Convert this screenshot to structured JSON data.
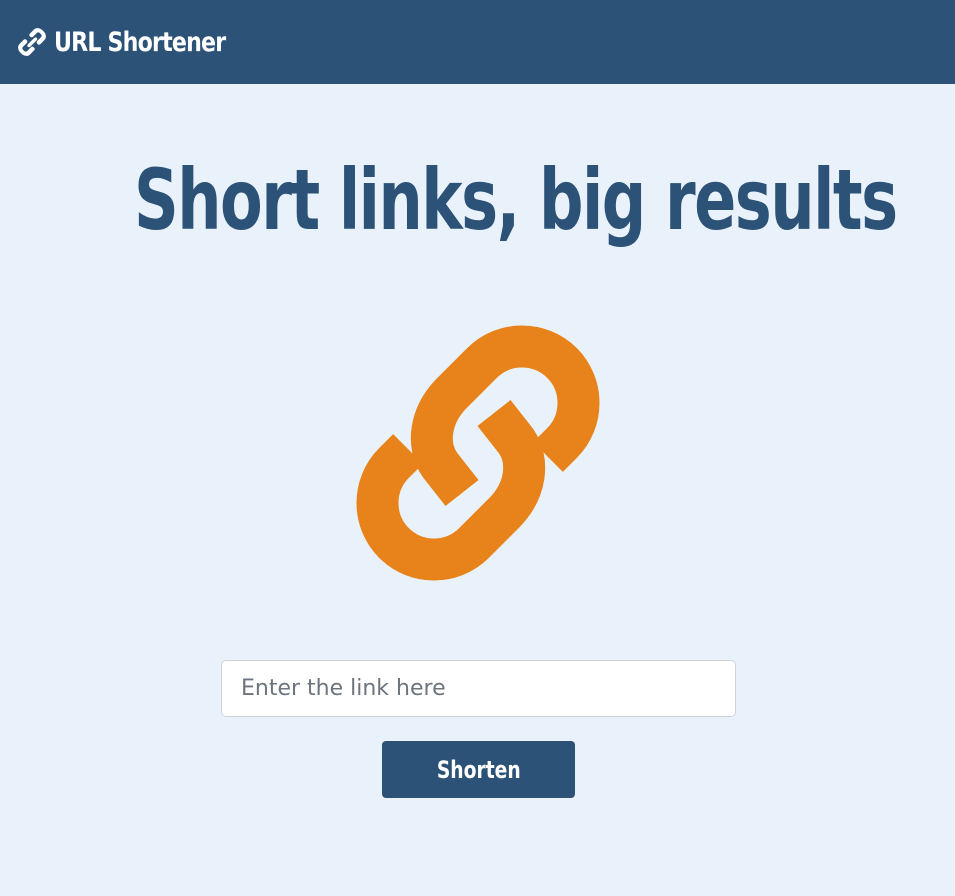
{
  "navbar": {
    "brand_icon": "link-icon",
    "brand_text": "URL Shortener",
    "background_color": "#2c5277"
  },
  "hero": {
    "title": "Short links, big results",
    "title_color": "#2c5277",
    "illustration_icon": "chain-link-icon",
    "illustration_color": "#e8821a"
  },
  "form": {
    "input_placeholder": "Enter the link here",
    "input_value": "",
    "submit_label": "Shorten"
  },
  "page": {
    "background_color": "#e9f2fa"
  }
}
